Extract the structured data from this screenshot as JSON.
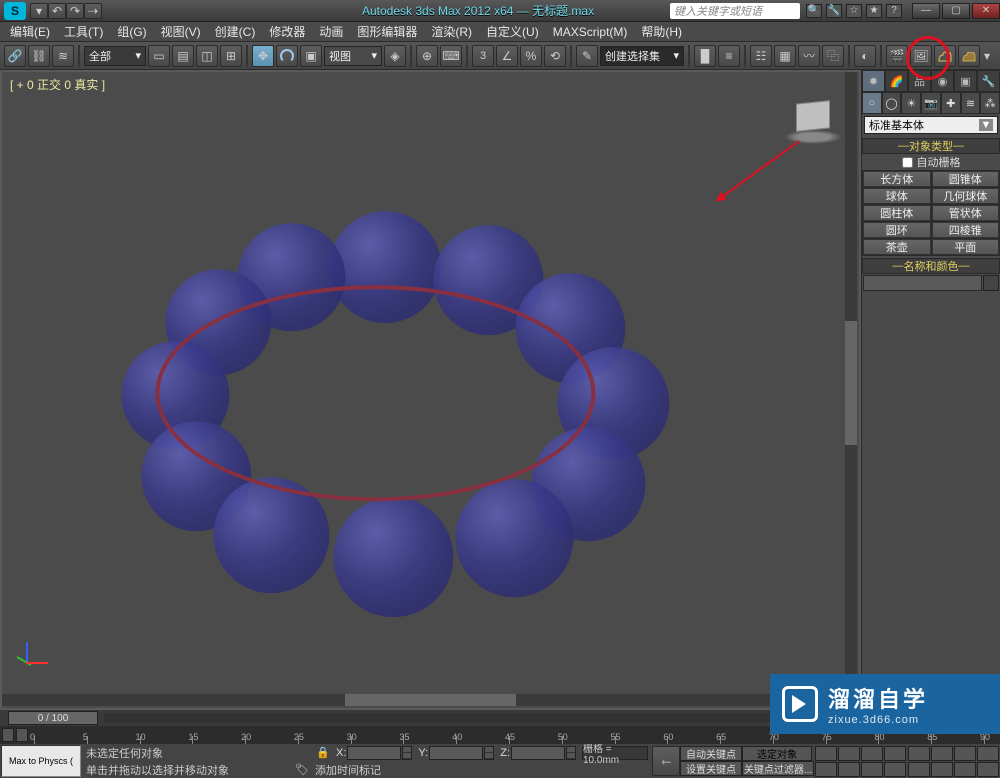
{
  "title": "Autodesk 3ds Max  2012 x64 — 无标题.max",
  "search_placeholder": "键入关键字或短语",
  "menu": [
    "编辑(E)",
    "工具(T)",
    "组(G)",
    "视图(V)",
    "创建(C)",
    "修改器",
    "动画",
    "图形编辑器",
    "渲染(R)",
    "自定义(U)",
    "MAXScript(M)",
    "帮助(H)"
  ],
  "layer_sel": "全部",
  "view_sel": "视图",
  "angle_snap": "3",
  "create_set": "创建选择集",
  "viewport_label": "[ + 0 正交 0 真实 ]",
  "cmd": {
    "category": "标准基本体",
    "r_objtype": "对象类型",
    "autogrid": "自动栅格",
    "prims": [
      "长方体",
      "圆锥体",
      "球体",
      "几何球体",
      "圆柱体",
      "管状体",
      "圆环",
      "四棱锥",
      "茶壶",
      "平面"
    ],
    "r_namecolor": "名称和颜色"
  },
  "time": {
    "handle": "0 / 100",
    "ticks": [
      0,
      5,
      10,
      15,
      20,
      25,
      30,
      35,
      40,
      45,
      50,
      55,
      60,
      65,
      70,
      75,
      80,
      85,
      90
    ]
  },
  "status": {
    "script": "Max to Physcs (",
    "line1": "未选定任何对象",
    "line2": "单击并拖动以选择并移动对象",
    "add_time": "添加时间标记",
    "coords": {
      "x": "X:",
      "y": "Y:",
      "z": "Z:"
    },
    "grid": "栅格 = 10.0mm",
    "autokey": "自动关键点",
    "setkey": "设置关键点",
    "sel_combo": "选定对象",
    "filter": "关键点过滤器..."
  },
  "watermark": {
    "big": "溜溜自学",
    "small": "zixue.3d66.com"
  }
}
